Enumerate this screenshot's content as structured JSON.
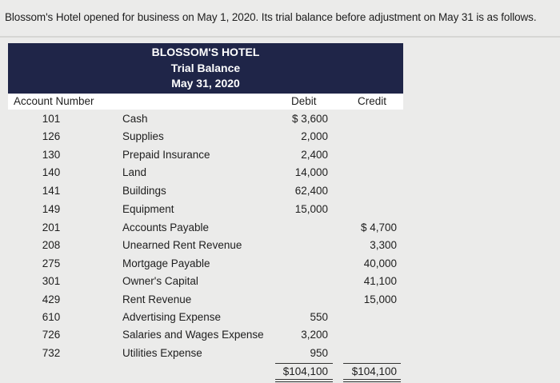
{
  "intro": "Blossom's Hotel opened for business on May 1, 2020. Its trial balance before adjustment on May 31 is as follows.",
  "banner": {
    "company": "BLOSSOM'S HOTEL",
    "report": "Trial Balance",
    "date": "May 31, 2020"
  },
  "headers": {
    "account_number": "Account Number",
    "debit": "Debit",
    "credit": "Credit"
  },
  "rows": [
    {
      "num": "101",
      "name": "Cash",
      "debit": "$ 3,600",
      "credit": ""
    },
    {
      "num": "126",
      "name": "Supplies",
      "debit": "2,000",
      "credit": ""
    },
    {
      "num": "130",
      "name": "Prepaid Insurance",
      "debit": "2,400",
      "credit": ""
    },
    {
      "num": "140",
      "name": "Land",
      "debit": "14,000",
      "credit": ""
    },
    {
      "num": "141",
      "name": "Buildings",
      "debit": "62,400",
      "credit": ""
    },
    {
      "num": "149",
      "name": "Equipment",
      "debit": "15,000",
      "credit": ""
    },
    {
      "num": "201",
      "name": "Accounts Payable",
      "debit": "",
      "credit": "$ 4,700"
    },
    {
      "num": "208",
      "name": "Unearned Rent Revenue",
      "debit": "",
      "credit": "3,300"
    },
    {
      "num": "275",
      "name": "Mortgage Payable",
      "debit": "",
      "credit": "40,000"
    },
    {
      "num": "301",
      "name": "Owner's Capital",
      "debit": "",
      "credit": "41,100"
    },
    {
      "num": "429",
      "name": "Rent Revenue",
      "debit": "",
      "credit": "15,000"
    },
    {
      "num": "610",
      "name": "Advertising Expense",
      "debit": "550",
      "credit": ""
    },
    {
      "num": "726",
      "name": "Salaries and Wages Expense",
      "debit": "3,200",
      "credit": ""
    },
    {
      "num": "732",
      "name": "Utilities Expense",
      "debit": "950",
      "credit": ""
    }
  ],
  "totals": {
    "debit": "$104,100",
    "credit": "$104,100"
  }
}
